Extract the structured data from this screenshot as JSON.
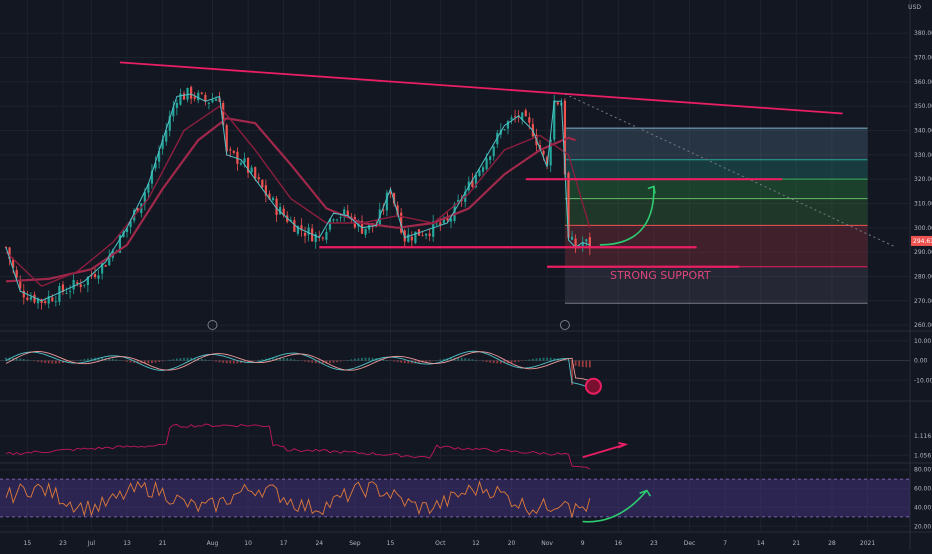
{
  "currency_label": "USD",
  "colors": {
    "bg": "#131722",
    "grid": "#1e222d",
    "text": "#b2b5be",
    "pink": "#e91e63",
    "teal": "#26a69a",
    "red": "#ef5350",
    "maroon": "#a0284b",
    "green": "#2ecc71",
    "purple": "#5b3fa8",
    "orange": "#e07b39"
  },
  "chart_data": [
    {
      "type": "candlestick",
      "ylim": [
        258,
        392
      ],
      "yticks": [
        "380.00",
        "370.00",
        "360.00",
        "350.00",
        "340.00",
        "330.00",
        "320.00",
        "310.00",
        "300.00",
        "290.00",
        "280.00",
        "270.00",
        "260.00"
      ],
      "ytick_values": [
        380,
        370,
        360,
        350,
        340,
        330,
        320,
        310,
        300,
        290,
        280,
        270,
        260
      ],
      "xticks": [
        "15",
        "23",
        "Jul",
        "13",
        "21",
        "Aug",
        "10",
        "17",
        "24",
        "Sep",
        "15",
        "Oct",
        "12",
        "20",
        "Nov",
        "9",
        "16",
        "23",
        "Dec",
        "7",
        "14",
        "21",
        "28",
        "2021"
      ],
      "xtick_index": [
        6,
        16,
        24,
        34,
        44,
        58,
        68,
        78,
        88,
        98,
        108,
        122,
        132,
        142,
        152,
        162,
        172,
        182,
        192,
        202,
        212,
        222,
        232,
        242
      ],
      "n_bars": 256,
      "price_label": "294.61",
      "annotation": "STRONG SUPPORT",
      "close_path": [
        [
          0,
          292
        ],
        [
          4,
          274
        ],
        [
          10,
          270
        ],
        [
          16,
          274
        ],
        [
          22,
          278
        ],
        [
          28,
          286
        ],
        [
          34,
          300
        ],
        [
          40,
          318
        ],
        [
          44,
          336
        ],
        [
          48,
          354
        ],
        [
          52,
          355
        ],
        [
          56,
          352
        ],
        [
          60,
          354
        ],
        [
          62,
          330
        ],
        [
          66,
          328
        ],
        [
          70,
          320
        ],
        [
          76,
          308
        ],
        [
          82,
          300
        ],
        [
          88,
          296
        ],
        [
          92,
          306
        ],
        [
          96,
          305
        ],
        [
          100,
          300
        ],
        [
          104,
          301
        ],
        [
          108,
          316
        ],
        [
          112,
          296
        ],
        [
          116,
          298
        ],
        [
          120,
          300
        ],
        [
          124,
          302
        ],
        [
          128,
          312
        ],
        [
          132,
          322
        ],
        [
          136,
          332
        ],
        [
          140,
          342
        ],
        [
          144,
          346
        ],
        [
          148,
          340
        ],
        [
          152,
          325
        ],
        [
          154,
          352
        ],
        [
          156,
          352
        ],
        [
          158,
          295
        ],
        [
          160,
          292
        ],
        [
          162,
          294
        ],
        [
          164,
          293
        ]
      ],
      "ma_fast": [
        [
          0,
          290
        ],
        [
          10,
          276
        ],
        [
          20,
          282
        ],
        [
          30,
          294
        ],
        [
          40,
          312
        ],
        [
          50,
          340
        ],
        [
          60,
          350
        ],
        [
          70,
          332
        ],
        [
          80,
          312
        ],
        [
          90,
          302
        ],
        [
          100,
          302
        ],
        [
          110,
          305
        ],
        [
          120,
          302
        ],
        [
          130,
          314
        ],
        [
          140,
          332
        ],
        [
          150,
          338
        ],
        [
          158,
          330
        ],
        [
          164,
          300
        ]
      ],
      "ma_slow": [
        [
          0,
          278
        ],
        [
          12,
          279
        ],
        [
          24,
          283
        ],
        [
          34,
          293
        ],
        [
          44,
          316
        ],
        [
          54,
          336
        ],
        [
          62,
          345
        ],
        [
          70,
          343
        ],
        [
          80,
          326
        ],
        [
          90,
          308
        ],
        [
          100,
          302
        ],
        [
          110,
          300
        ],
        [
          120,
          302
        ],
        [
          130,
          308
        ],
        [
          140,
          322
        ],
        [
          150,
          332
        ],
        [
          158,
          337
        ],
        [
          160,
          336
        ]
      ],
      "trendline": [
        [
          32,
          368
        ],
        [
          235,
          347
        ]
      ],
      "dotted_line": [
        [
          157,
          355
        ],
        [
          250,
          292
        ]
      ],
      "supports": [
        [
          88,
          292,
          194
        ],
        [
          146,
          320,
          218
        ],
        [
          152,
          284,
          206
        ]
      ],
      "fib_box": {
        "x0": 157,
        "x1": 242,
        "top": 341,
        "bottom": 269,
        "levels": [
          341,
          328,
          320,
          312,
          301,
          284,
          269
        ]
      }
    },
    {
      "type": "line",
      "name_hint": "oscillator",
      "ylim": [
        -20,
        14
      ],
      "yticks": [
        "10.00",
        "0.00",
        "-10.00"
      ],
      "ytick_values": [
        10,
        0,
        -10
      ]
    },
    {
      "type": "line",
      "ylim": [
        1.035,
        1.22
      ],
      "yticks": [
        "1.116",
        "1.056"
      ],
      "ytick_values": [
        1.116,
        1.056
      ]
    },
    {
      "type": "line",
      "ylim": [
        15,
        85
      ],
      "yticks": [
        "80.00",
        "60.00",
        "40.00",
        "20.00"
      ],
      "ytick_values": [
        80,
        60,
        40,
        20
      ],
      "band": [
        30,
        70
      ]
    }
  ]
}
